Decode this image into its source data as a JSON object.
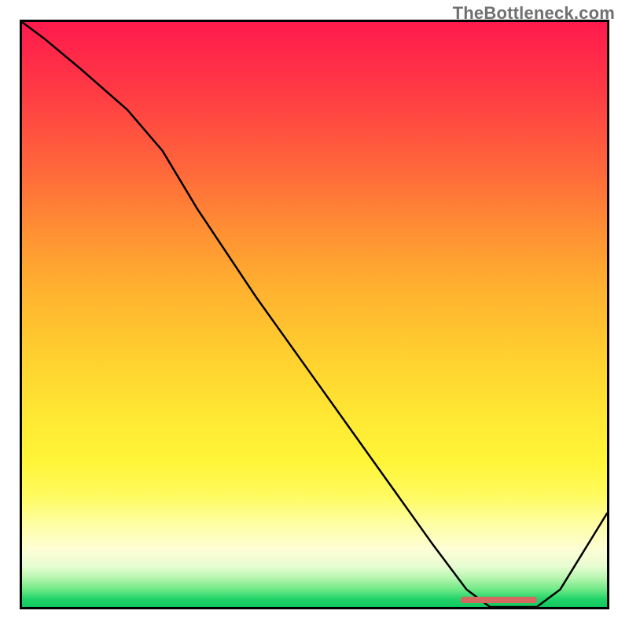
{
  "watermark": "TheBottleneck.com",
  "chart_data": {
    "type": "line",
    "title": "",
    "xlabel": "",
    "ylabel": "",
    "xlim": [
      0,
      100
    ],
    "ylim": [
      0,
      100
    ],
    "x": [
      0,
      4,
      10,
      18,
      24,
      30,
      40,
      50,
      60,
      70,
      76,
      80,
      84,
      88,
      92,
      100
    ],
    "y": [
      100,
      97,
      92,
      85,
      78,
      68,
      53,
      39,
      25,
      11,
      3,
      0,
      0,
      0,
      3,
      16
    ],
    "marker": {
      "x_start": 75,
      "x_end": 88,
      "y": 0
    },
    "gradient_stops": [
      {
        "pos": 0,
        "color": "#ff1a4d"
      },
      {
        "pos": 0.26,
        "color": "#ff6a3a"
      },
      {
        "pos": 0.58,
        "color": "#ffd22f"
      },
      {
        "pos": 0.86,
        "color": "#fefea6"
      },
      {
        "pos": 0.97,
        "color": "#6fe985"
      },
      {
        "pos": 1.0,
        "color": "#0fc85f"
      }
    ]
  }
}
